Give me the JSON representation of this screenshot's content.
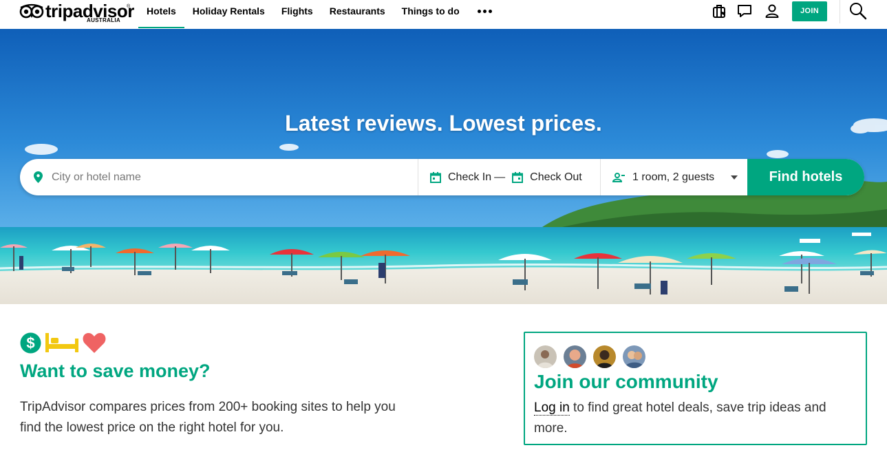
{
  "brand": {
    "name": "tripadvisor",
    "region": "AUSTRALIA",
    "trademark": "®"
  },
  "nav": {
    "items": [
      {
        "label": "Hotels",
        "active": true
      },
      {
        "label": "Holiday Rentals",
        "active": false
      },
      {
        "label": "Flights",
        "active": false
      },
      {
        "label": "Restaurants",
        "active": false
      },
      {
        "label": "Things to do",
        "active": false
      }
    ],
    "more_icon": "more-dots-icon"
  },
  "header_actions": {
    "trips_icon": "suitcase-heart-icon",
    "messages_icon": "chat-bubble-icon",
    "profile_icon": "person-icon",
    "join_label": "JOIN",
    "search_icon": "search-icon"
  },
  "hero": {
    "title": "Latest reviews. Lowest prices.",
    "search": {
      "location_placeholder": "City or hotel name",
      "check_in": "Check In",
      "dates_separator": "—",
      "check_out": "Check Out",
      "guests": "1 room, 2 guests",
      "button": "Find hotels"
    }
  },
  "save": {
    "icons": [
      "dollar-icon",
      "bed-icon",
      "heart-icon"
    ],
    "title": "Want to save money?",
    "text": "TripAdvisor compares prices from 200+ booking sites to help you find the lowest price on the right hotel for you."
  },
  "community": {
    "title": "Join our community",
    "login_link": "Log in",
    "text": " to find great hotel deals, save trip ideas and more."
  },
  "colors": {
    "accent": "#00a680",
    "dollar": "#00a680",
    "bed": "#f2c811",
    "heart": "#ef6363"
  }
}
